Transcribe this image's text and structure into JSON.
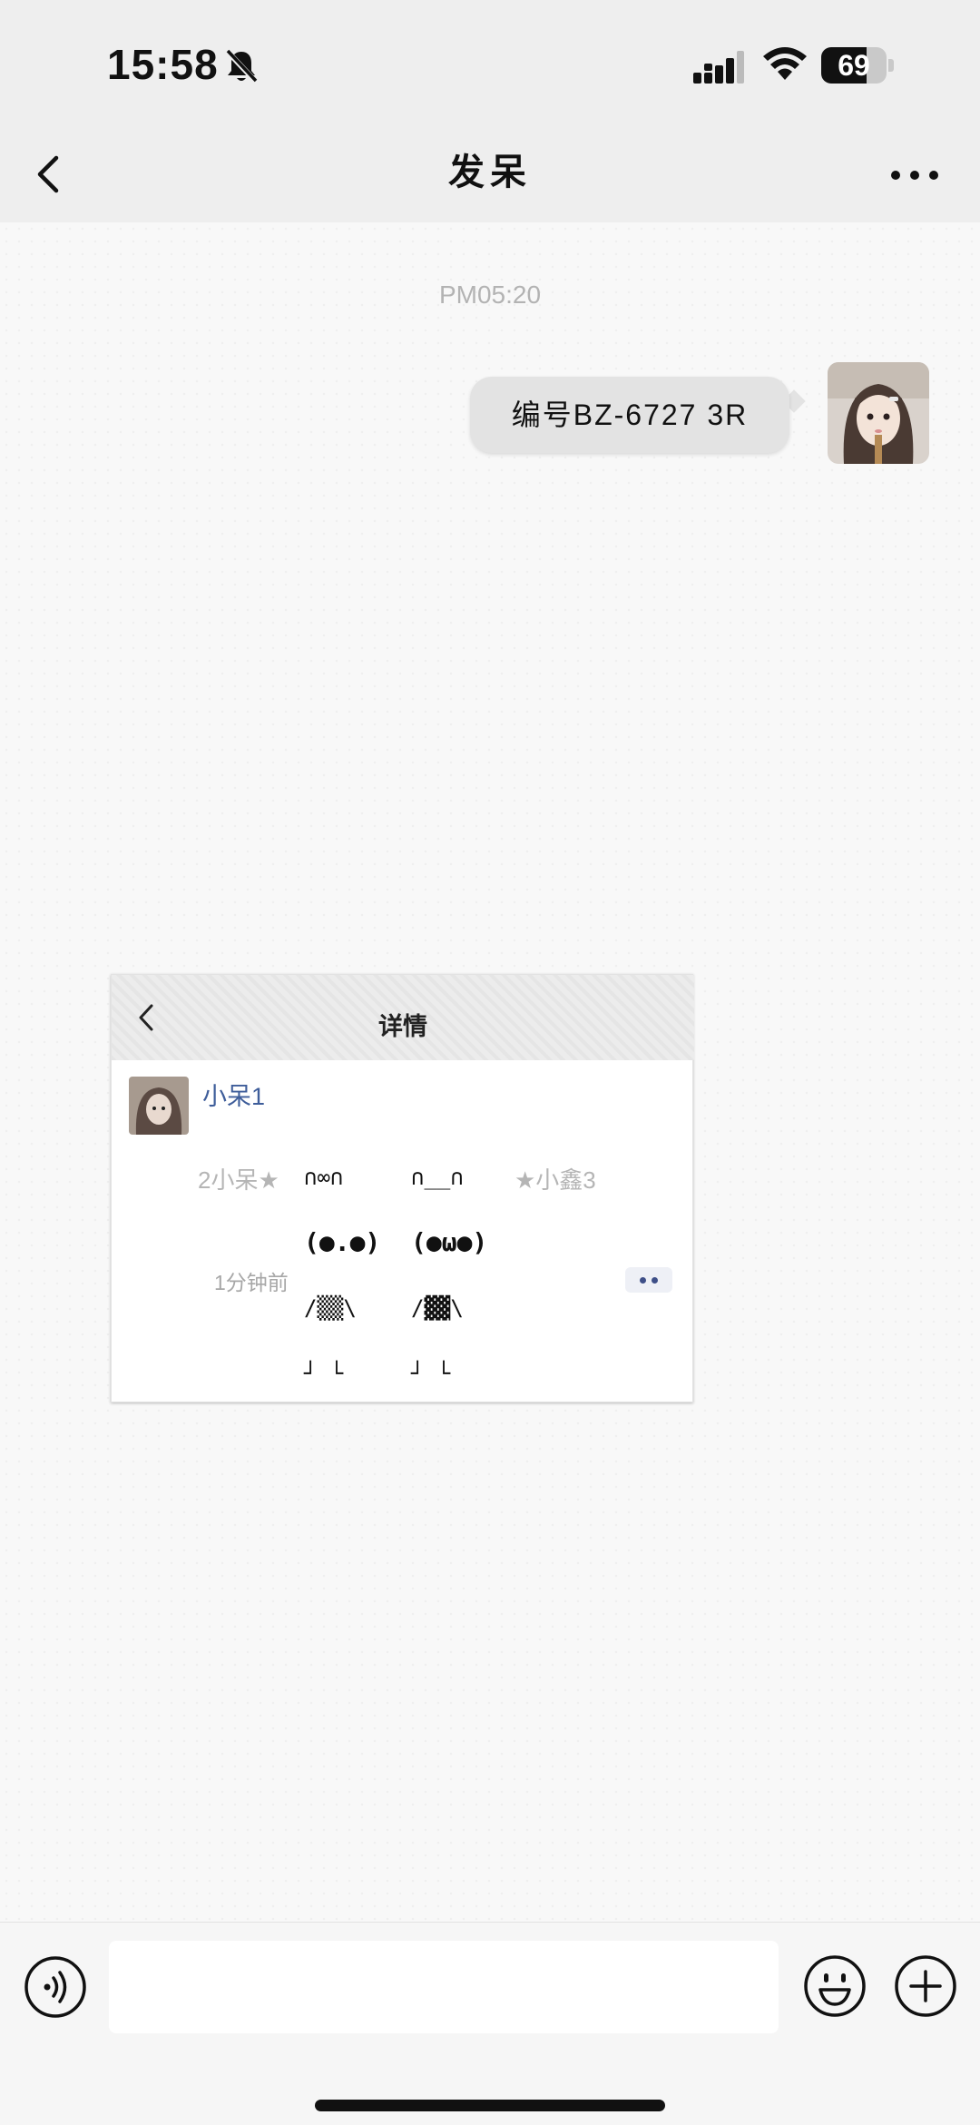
{
  "status_bar": {
    "time": "15:58",
    "battery": "69",
    "battery_percent": 69,
    "muted": true
  },
  "nav": {
    "title": "发呆",
    "back_icon": "chevron-left-icon",
    "more_icon": "more-dots-icon"
  },
  "chat": {
    "timestamp": "PM05:20",
    "messages": [
      {
        "type": "text",
        "side": "right",
        "text": "编号BZ-6727 3R"
      },
      {
        "type": "image",
        "side": "left"
      }
    ]
  },
  "image_card": {
    "title": "详情",
    "username": "小呆1",
    "left_name": "2小呆★",
    "right_name": "★小鑫3",
    "kaomoji_left": [
      "∩∞∩",
      "(●.●)",
      "/▒▒\\",
      "┘ └"
    ],
    "kaomoji_right": [
      "∩__∩",
      "(●ω●)",
      "/▓▓\\",
      "┘ └"
    ],
    "time_ago": "1分钟前"
  },
  "input_bar": {
    "voice_icon": "voice-icon",
    "input_value": "",
    "emoji_icon": "emoji-icon",
    "plus_icon": "plus-icon"
  },
  "colors": {
    "bar_bg": "#eeeeee",
    "bubble_bg": "#e3e3e3",
    "link_blue": "#3e5d9a"
  }
}
